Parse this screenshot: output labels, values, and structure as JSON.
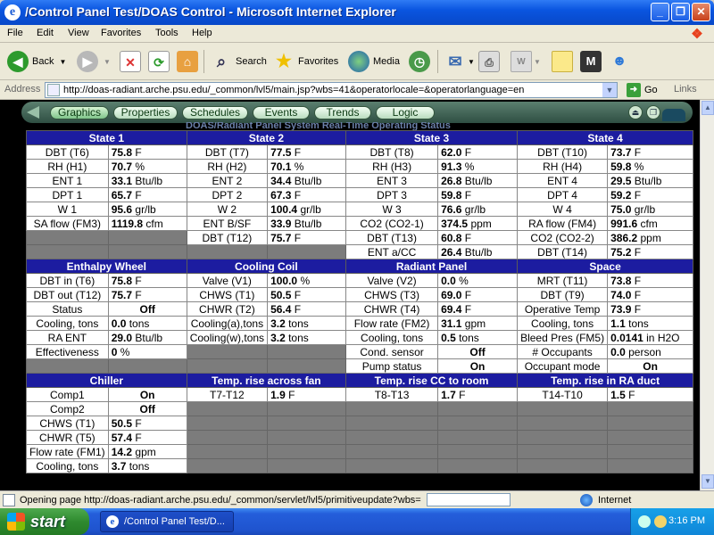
{
  "window": {
    "title": "/Control Panel Test/DOAS Control - Microsoft Internet Explorer",
    "minimize": "_",
    "maximize": "❐",
    "close": "✕"
  },
  "menu": [
    "File",
    "Edit",
    "View",
    "Favorites",
    "Tools",
    "Help"
  ],
  "toolbar": {
    "back": "Back",
    "search": "Search",
    "favorites": "Favorites",
    "media": "Media"
  },
  "address": {
    "label": "Address",
    "url": "http://doas-radiant.arche.psu.edu/_common/lvl5/main.jsp?wbs=41&operatorlocale=&operatorlanguage=en",
    "go": "Go",
    "links": "Links"
  },
  "nav": [
    "Graphics",
    "Properties",
    "Schedules",
    "Events",
    "Trends",
    "Logic"
  ],
  "page": {
    "subtitle": "DOAS/Radiant Panel System Real-Time Operating Status"
  },
  "grid": {
    "sections": [
      {
        "headers": [
          "State 1",
          "State 2",
          "State 3",
          "State 4"
        ],
        "rows": [
          [
            [
              "DBT (T6)",
              "75.8",
              "F"
            ],
            [
              "DBT (T7)",
              "77.5",
              "F"
            ],
            [
              "DBT (T8)",
              "62.0",
              "F"
            ],
            [
              "DBT (T10)",
              "73.7",
              "F"
            ]
          ],
          [
            [
              "RH (H1)",
              "70.7",
              "%"
            ],
            [
              "RH (H2)",
              "70.1",
              "%"
            ],
            [
              "RH (H3)",
              "91.3",
              "%"
            ],
            [
              "RH (H4)",
              "59.8",
              "%"
            ]
          ],
          [
            [
              "ENT 1",
              "33.1",
              "Btu/lb"
            ],
            [
              "ENT 2",
              "34.4",
              "Btu/lb"
            ],
            [
              "ENT 3",
              "26.8",
              "Btu/lb"
            ],
            [
              "ENT 4",
              "29.5",
              "Btu/lb"
            ]
          ],
          [
            [
              "DPT 1",
              "65.7",
              "F"
            ],
            [
              "DPT 2",
              "67.3",
              "F"
            ],
            [
              "DPT 3",
              "59.8",
              "F"
            ],
            [
              "DPT 4",
              "59.2",
              "F"
            ]
          ],
          [
            [
              "W 1",
              "95.6",
              "gr/lb"
            ],
            [
              "W 2",
              "100.4",
              "gr/lb"
            ],
            [
              "W 3",
              "76.6",
              "gr/lb"
            ],
            [
              "W 4",
              "75.0",
              "gr/lb"
            ]
          ],
          [
            [
              "SA flow (FM3)",
              "1119.8",
              "cfm"
            ],
            [
              "ENT B/SF",
              "33.9",
              "Btu/lb"
            ],
            [
              "CO2 (CO2-1)",
              "374.5",
              "ppm"
            ],
            [
              "RA flow (FM4)",
              "991.6",
              "cfm"
            ]
          ],
          [
            null,
            [
              "DBT (T12)",
              "75.7",
              "F"
            ],
            [
              "DBT (T13)",
              "60.8",
              "F"
            ],
            [
              "CO2 (CO2-2)",
              "386.2",
              "ppm"
            ]
          ],
          [
            null,
            null,
            [
              "ENT a/CC",
              "26.4",
              "Btu/lb"
            ],
            [
              "DBT (T14)",
              "75.2",
              "F"
            ]
          ]
        ]
      },
      {
        "headers": [
          "Enthalpy Wheel",
          "Cooling Coil",
          "Radiant Panel",
          "Space"
        ],
        "rows": [
          [
            [
              "DBT in (T6)",
              "75.8",
              "F"
            ],
            [
              "Valve (V1)",
              "100.0",
              "%"
            ],
            [
              "Valve (V2)",
              "0.0",
              "%"
            ],
            [
              "MRT (T11)",
              "73.8",
              "F"
            ]
          ],
          [
            [
              "DBT out (T12)",
              "75.7",
              "F"
            ],
            [
              "CHWS (T1)",
              "50.5",
              "F"
            ],
            [
              "CHWS (T3)",
              "69.0",
              "F"
            ],
            [
              "DBT (T9)",
              "74.0",
              "F"
            ]
          ],
          [
            [
              "Status",
              "Off",
              ""
            ],
            [
              "CHWR (T2)",
              "56.4",
              "F"
            ],
            [
              "CHWR (T4)",
              "69.4",
              "F"
            ],
            [
              "Operative Temp",
              "73.9",
              "F"
            ]
          ],
          [
            [
              "Cooling, tons",
              "0.0",
              "tons"
            ],
            [
              "Cooling(a),tons",
              "3.2",
              "tons"
            ],
            [
              "Flow rate (FM2)",
              "31.1",
              "gpm"
            ],
            [
              "Cooling, tons",
              "1.1",
              "tons"
            ]
          ],
          [
            [
              "RA ENT",
              "29.0",
              "Btu/lb"
            ],
            [
              "Cooling(w),tons",
              "3.2",
              "tons"
            ],
            [
              "Cooling, tons",
              "0.5",
              "tons"
            ],
            [
              "Bleed Pres (FM5)",
              "0.0141",
              "in H2O"
            ]
          ],
          [
            [
              "Effectiveness",
              "0",
              "%"
            ],
            null,
            [
              "Cond. sensor",
              "Off",
              ""
            ],
            [
              "# Occupants",
              "0.0",
              "person"
            ]
          ],
          [
            null,
            null,
            [
              "Pump status",
              "On",
              ""
            ],
            [
              "Occupant mode",
              "On",
              ""
            ]
          ]
        ]
      },
      {
        "headers": [
          "Chiller",
          "Temp. rise across fan",
          "Temp. rise CC to room",
          "Temp. rise in RA duct"
        ],
        "rows": [
          [
            [
              "Comp1",
              "On",
              ""
            ],
            [
              "T7-T12",
              "1.9",
              "F"
            ],
            [
              "T8-T13",
              "1.7",
              "F"
            ],
            [
              "T14-T10",
              "1.5",
              "F"
            ]
          ],
          [
            [
              "Comp2",
              "Off",
              ""
            ],
            null,
            null,
            null
          ],
          [
            [
              "CHWS (T1)",
              "50.5",
              "F"
            ],
            null,
            null,
            null
          ],
          [
            [
              "CHWR (T5)",
              "57.4",
              "F"
            ],
            null,
            null,
            null
          ],
          [
            [
              "Flow rate (FM1)",
              "14.2",
              "gpm"
            ],
            null,
            null,
            null
          ],
          [
            [
              "Cooling, tons",
              "3.7",
              "tons"
            ],
            null,
            null,
            null
          ]
        ]
      }
    ]
  },
  "status": {
    "text": "Opening page http://doas-radiant.arche.psu.edu/_common/servlet/lvl5/primitiveupdate?wbs=",
    "zone": "Internet"
  },
  "taskbar": {
    "start": "start",
    "task": "/Control Panel Test/D...",
    "clock": "3:16 PM"
  }
}
